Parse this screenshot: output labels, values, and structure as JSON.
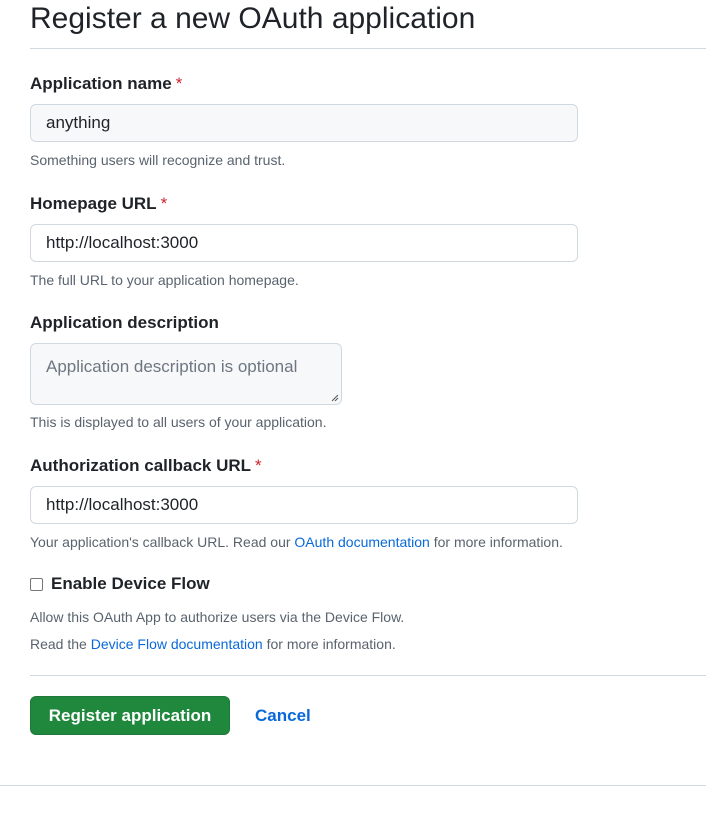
{
  "form": {
    "title": "Register a new OAuth application",
    "required_marker": "*",
    "application_name": {
      "label": "Application name",
      "value": "anything",
      "hint": "Something users will recognize and trust."
    },
    "homepage_url": {
      "label": "Homepage URL",
      "value": "http://localhost:3000",
      "hint": "The full URL to your application homepage."
    },
    "description": {
      "label": "Application description",
      "placeholder": "Application description is optional",
      "hint": "This is displayed to all users of your application."
    },
    "callback_url": {
      "label": "Authorization callback URL",
      "value": "http://localhost:3000",
      "hint_before": "Your application's callback URL. Read our ",
      "hint_link": "OAuth documentation",
      "hint_after": " for more information."
    },
    "device_flow": {
      "label": "Enable Device Flow",
      "checked": false,
      "hint1": "Allow this OAuth App to authorize users via the Device Flow.",
      "hint2_before": "Read the ",
      "hint2_link": "Device Flow documentation",
      "hint2_after": " for more information."
    },
    "actions": {
      "register_label": "Register application",
      "cancel_label": "Cancel"
    }
  },
  "colors": {
    "primary_button": "#1f883d",
    "link": "#0969da",
    "required": "#cf222e"
  }
}
